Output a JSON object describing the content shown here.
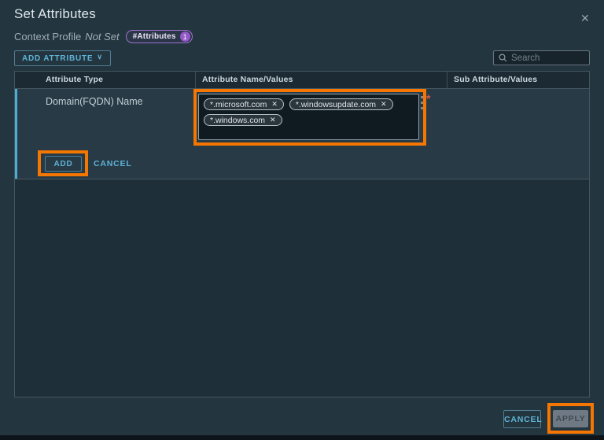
{
  "dialog": {
    "title": "Set Attributes",
    "context_label": "Context Profile",
    "context_value": "Not Set",
    "badge": {
      "label": "#Attributes",
      "count": "1"
    }
  },
  "toolbar": {
    "add_attribute_label": "ADD ATTRIBUTE",
    "search_placeholder": "Search"
  },
  "table": {
    "columns": [
      "Attribute Type",
      "Attribute Name/Values",
      "Sub Attribute/Values"
    ],
    "row": {
      "attribute_type": "Domain(FQDN) Name",
      "values": [
        "*.microsoft.com",
        "*.windowsupdate.com",
        "*.windows.com"
      ],
      "required_marker": "*",
      "add_label": "ADD",
      "cancel_label": "CANCEL"
    }
  },
  "footer": {
    "cancel_label": "CANCEL",
    "apply_label": "APPLY"
  },
  "icons": {
    "close": "✕",
    "chevron_down": "∨",
    "remove_tag": "✕"
  },
  "colors": {
    "accent_blue": "#5fb3d6",
    "annotation_orange": "#f57600",
    "badge_purple": "#9458c8",
    "required_red": "#cf5c4e",
    "apply_disabled_bg": "#6e7984"
  }
}
